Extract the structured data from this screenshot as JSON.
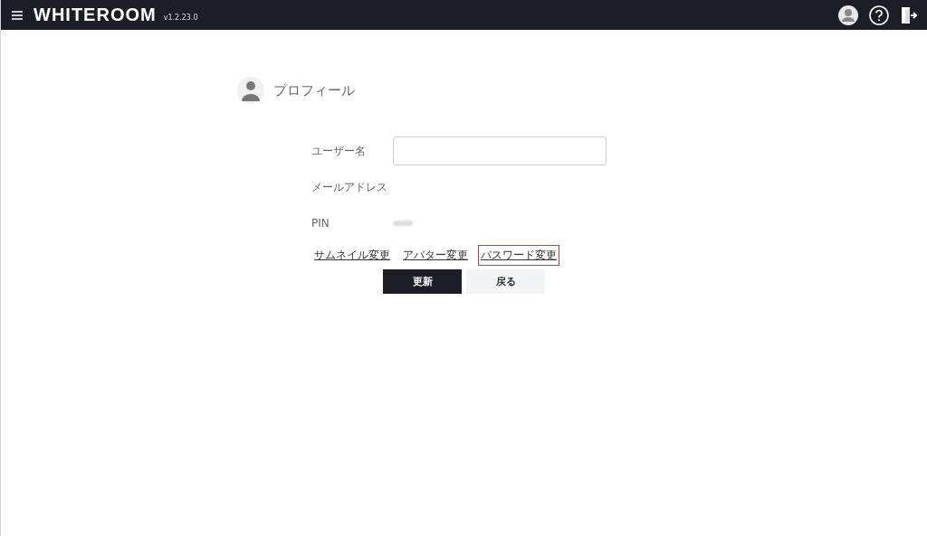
{
  "header": {
    "logo": "WHITEROOM",
    "version": "v1.2.23.0"
  },
  "profile": {
    "title": "プロフィール"
  },
  "form": {
    "fields": [
      {
        "kind": "input",
        "label": "ユーザー名"
      },
      {
        "kind": "text",
        "label": "メールアドレス"
      },
      {
        "kind": "hidden",
        "label": "PIN"
      }
    ]
  },
  "links": [
    {
      "label": "サムネイル変更",
      "highlighted": false
    },
    {
      "label": "アバター変更",
      "highlighted": false
    },
    {
      "label": "パスワード変更",
      "highlighted": true
    }
  ],
  "buttons": [
    {
      "kind": "primary",
      "label": "更新"
    },
    {
      "kind": "secondary",
      "label": "戻る"
    }
  ]
}
